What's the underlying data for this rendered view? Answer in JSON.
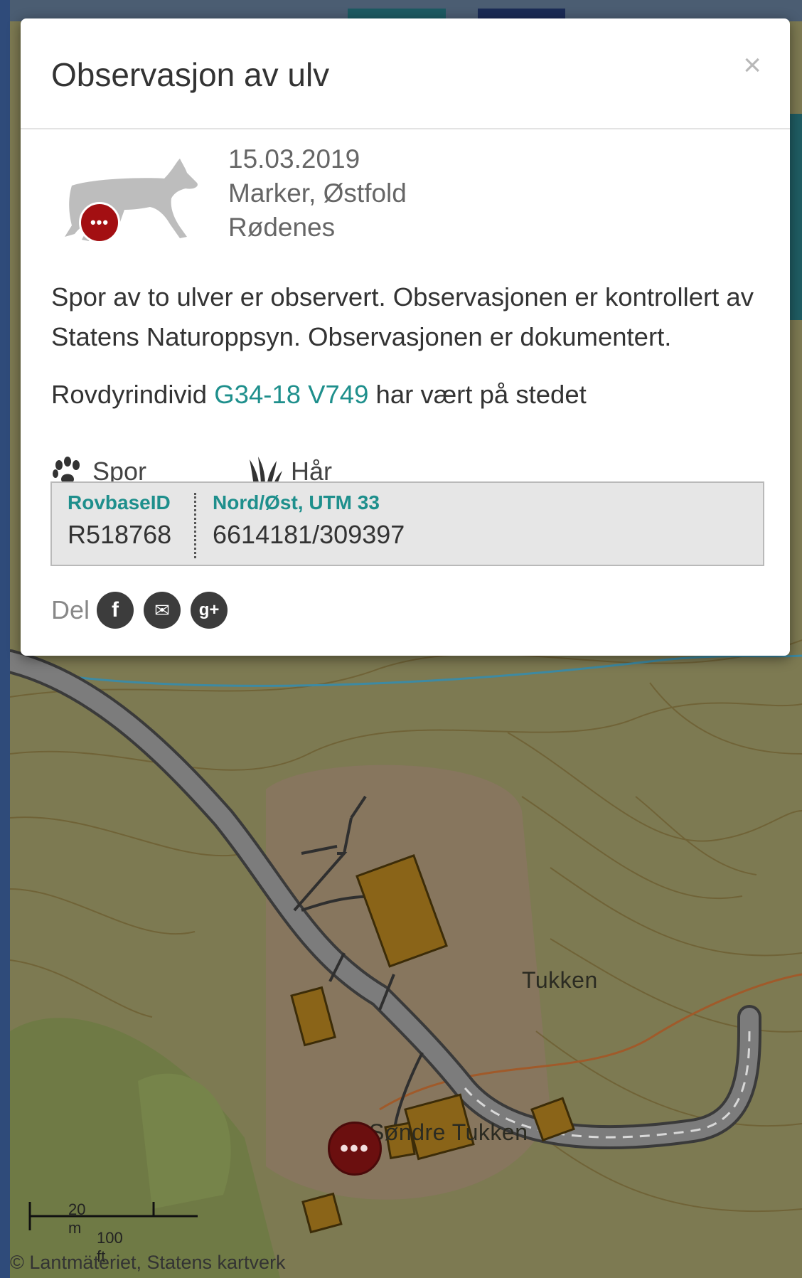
{
  "modal": {
    "title": "Observasjon av ulv",
    "close_label": "×",
    "badge_text": "•••",
    "date": "15.03.2019",
    "location": "Marker, Østfold",
    "place": "Rødenes",
    "description": "Spor av to ulver er observert. Observasjonen er kontrollert av Statens Naturoppsyn. Observasjonen er dokumentert.",
    "individual": {
      "prefix": "Rovdyrindivid",
      "link_text": "G34-18 V749",
      "suffix": "har vært på stedet"
    },
    "features": [
      {
        "icon": "paw-icon",
        "label": "Spor"
      },
      {
        "icon": "grass-hair-icon",
        "label": "Hår"
      }
    ],
    "ids": {
      "rovbase_label": "RovbaseID",
      "rovbase_value": "R518768",
      "coords_label": "Nord/Øst, UTM 33",
      "coords_value": "6614181/309397"
    },
    "share": {
      "label": "Del",
      "facebook": "f",
      "email": "✉",
      "google": "g+"
    }
  },
  "map": {
    "labels": {
      "tukken": "Tukken",
      "sondre_tukken": "Søndre Tukken"
    },
    "marker_text": "•••",
    "scale_m": "20 m",
    "scale_ft": "100 ft",
    "attribution": "© Lantmäteriet, Statens kartverk"
  },
  "colors": {
    "accent": "#1e8f8c",
    "marker": "#a30f12",
    "building": "#8a6418"
  }
}
